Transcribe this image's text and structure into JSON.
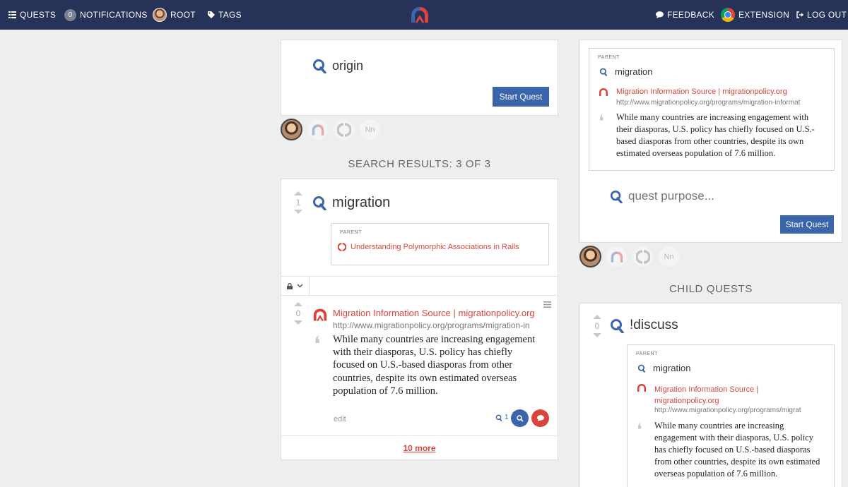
{
  "nav": {
    "quests": "QUESTS",
    "notif_count": "0",
    "notifications": "NOTIFICATIONS",
    "root": "ROOT",
    "tags": "TAGS",
    "feedback": "FEEDBACK",
    "extension": "EXTENSION",
    "logout": "LOG OUT"
  },
  "origin_card": {
    "title": "origin",
    "button": "Start Quest"
  },
  "avatars": [
    "Nn"
  ],
  "search_heading": "SEARCH RESULTS: 3 OF 3",
  "result": {
    "votes": "1",
    "title": "migration",
    "parent_label": "PARENT",
    "parent_link": "Understanding Polymorphic Associations in Rails"
  },
  "entry": {
    "votes": "0",
    "source_title": "Migration Information Source | migrationpolicy.org",
    "url": "http://www.migrationpolicy.org/programs/migration-in",
    "quote": "While many countries are increasing engagement with their diasporas, U.S. policy has chiefly focused on U.S.-based diasporas from other countries, despite its own estimated overseas population of 7.6 million.",
    "edit": "edit",
    "quest_count": "1",
    "more": "10 more"
  },
  "right_panel": {
    "parent_label": "PARENT",
    "parent_title": "migration",
    "source_title": "Migration Information Source | migrationpolicy.org",
    "url": "http://www.migrationpolicy.org/programs/migration-informat",
    "quote": "While many countries are increasing engagement with their diasporas, U.S. policy has chiefly focused on U.S.-based diasporas from other countries, despite its own estimated overseas population of 7.6 million.",
    "purpose_placeholder": "quest purpose...",
    "button": "Start Quest"
  },
  "child_heading": "CHILD QUESTS",
  "child": {
    "votes": "0",
    "title": "!discuss",
    "parent_label": "PARENT",
    "parent_title": "migration",
    "source_title_1": "Migration Information Source |",
    "source_title_2": "migrationpolicy.org",
    "url": "http://www.migrationpolicy.org/programs/migrat",
    "quote": "While many countries are increasing engagement with their diasporas, U.S. policy has chiefly focused on U.S.-based diasporas from other countries, despite its own estimated overseas population of 7.6 million."
  },
  "colors": {
    "nav_bg": "#263258",
    "primary": "#3b65aa",
    "link_red": "#d9453c"
  },
  "icons": [
    "list-icon",
    "tag-icon",
    "comment-icon",
    "chrome-icon",
    "logout-icon",
    "quest-icon",
    "lock-icon",
    "chevron-down-icon",
    "hamburger-icon",
    "search-icon",
    "quote-icon"
  ]
}
